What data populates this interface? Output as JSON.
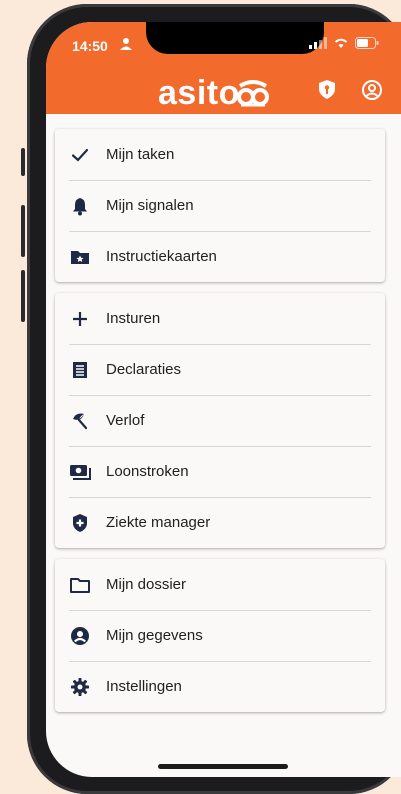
{
  "status_bar": {
    "time": "14:50"
  },
  "header": {
    "brand": "asito",
    "icons": [
      "shield-icon",
      "account-icon"
    ]
  },
  "colors": {
    "brand_orange": "#f26b2d",
    "icon_navy": "#1e2a44",
    "background": "#fbe9da"
  },
  "menu": {
    "group1": [
      {
        "label": "Mijn taken",
        "icon": "check-icon"
      },
      {
        "label": "Mijn signalen",
        "icon": "bell-icon"
      },
      {
        "label": "Instructiekaarten",
        "icon": "starred-folder-icon"
      }
    ],
    "group2": [
      {
        "label": "Insturen",
        "icon": "plus-icon"
      },
      {
        "label": "Declaraties",
        "icon": "receipt-icon"
      },
      {
        "label": "Verlof",
        "icon": "beach-umbrella-icon"
      },
      {
        "label": "Loonstroken",
        "icon": "payslip-icon"
      },
      {
        "label": "Ziekte manager",
        "icon": "medical-shield-icon"
      }
    ],
    "group3": [
      {
        "label": "Mijn dossier",
        "icon": "folder-icon"
      },
      {
        "label": "Mijn gegevens",
        "icon": "user-circle-icon"
      },
      {
        "label": "Instellingen",
        "icon": "gear-icon"
      }
    ]
  }
}
